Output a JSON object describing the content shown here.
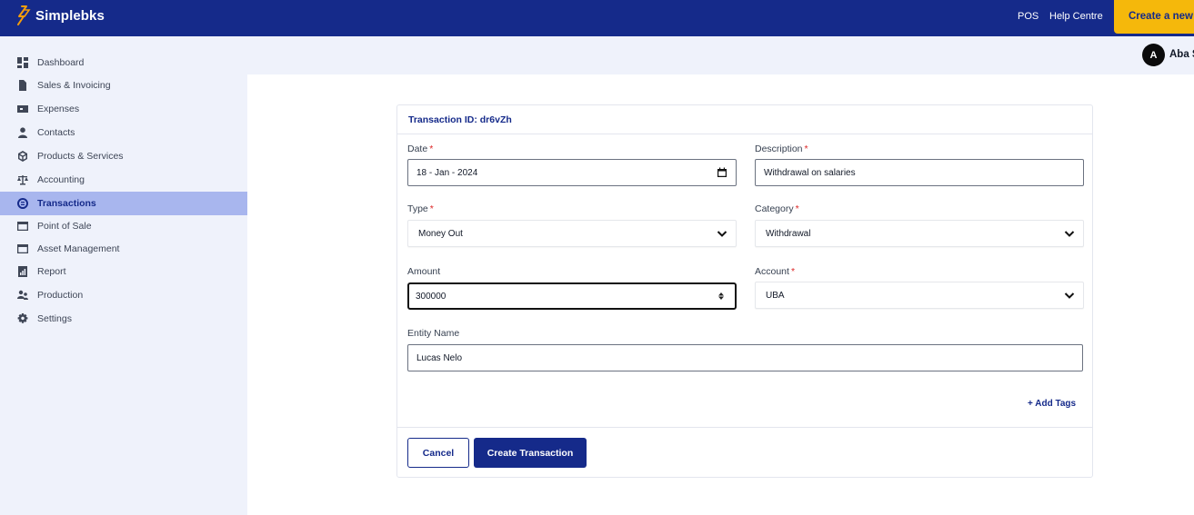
{
  "app": {
    "brand": "Simplebks",
    "top_links": {
      "pos": "POS",
      "help": "Help Centre"
    },
    "create_new_label": "Create a new"
  },
  "user": {
    "initial": "A",
    "name": "Aba S"
  },
  "sidebar": {
    "items": [
      {
        "label": "Dashboard",
        "icon": "dashboard-icon"
      },
      {
        "label": "Sales & Invoicing",
        "icon": "document-icon"
      },
      {
        "label": "Expenses",
        "icon": "wallet-icon"
      },
      {
        "label": "Contacts",
        "icon": "user-icon"
      },
      {
        "label": "Products & Services",
        "icon": "box-icon"
      },
      {
        "label": "Accounting",
        "icon": "scale-icon"
      },
      {
        "label": "Transactions",
        "icon": "exchange-icon",
        "active": true
      },
      {
        "label": "Point of Sale",
        "icon": "card-icon"
      },
      {
        "label": "Asset Management",
        "icon": "card-icon"
      },
      {
        "label": "Report",
        "icon": "report-icon"
      },
      {
        "label": "Production",
        "icon": "people-icon"
      },
      {
        "label": "Settings",
        "icon": "gear-icon"
      }
    ]
  },
  "form": {
    "header": "Transaction ID: dr6vZh",
    "date": {
      "label": "Date",
      "required_mark": "*",
      "value": "18 - Jan - 2024"
    },
    "description": {
      "label": "Description",
      "required_mark": "*",
      "value": "Withdrawal on salaries"
    },
    "type": {
      "label": "Type",
      "required_mark": "*",
      "value": "Money Out"
    },
    "category": {
      "label": "Category",
      "required_mark": "*",
      "value": "Withdrawal"
    },
    "amount": {
      "label": "Amount",
      "value": "300000"
    },
    "account": {
      "label": "Account",
      "required_mark": "*",
      "value": "UBA"
    },
    "entity": {
      "label": "Entity Name",
      "value": "Lucas Nelo"
    },
    "add_tags": "+ Add Tags",
    "cancel": "Cancel",
    "submit": "Create Transaction"
  },
  "colors": {
    "primary": "#152a8a",
    "accent": "#f5b80b",
    "sidebar_bg": "#eff2fb",
    "active_bg": "#a8b6ee",
    "required": "#dc2626"
  }
}
